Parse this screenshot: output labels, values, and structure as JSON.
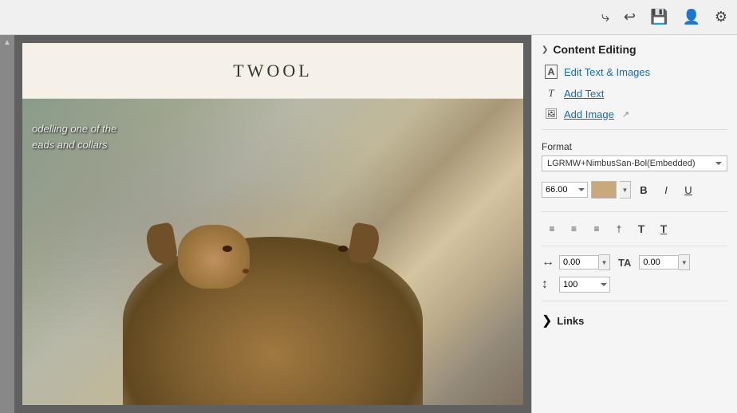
{
  "toolbar": {
    "icons": [
      "forward-icon",
      "back-icon",
      "save-icon",
      "profile-icon",
      "settings-icon"
    ]
  },
  "pdf": {
    "brand_name": "TWOOL",
    "text_line1": "odelling one of the",
    "text_line2": "eads and collars"
  },
  "right_panel": {
    "content_editing_label": "Content Editing",
    "collapse_arrow": "❯",
    "edit_text_images_label": "Edit Text & Images",
    "add_text_label": "Add Text",
    "add_image_label": "Add Image",
    "format_label": "Format",
    "font_dropdown_value": "LGRMW+NimbusSan-Bol(Embedded)",
    "font_size_value": "66.00",
    "bold_label": "B",
    "italic_label": "I",
    "underline_label": "U",
    "align_left": "≡",
    "align_center": "≡",
    "align_right": "≡",
    "align_justify": "⊞",
    "align_t1": "T",
    "align_t2": "T",
    "spacing_h_icon": "↔",
    "spacing_h_value": "0.00",
    "spacing_ta_icon": "TA",
    "spacing_ta_value": "0.00",
    "line_height_icon": "↕",
    "line_height_value": "100",
    "links_label": "Links",
    "links_collapse_arrow": "❯",
    "cursor_label": "↗"
  }
}
